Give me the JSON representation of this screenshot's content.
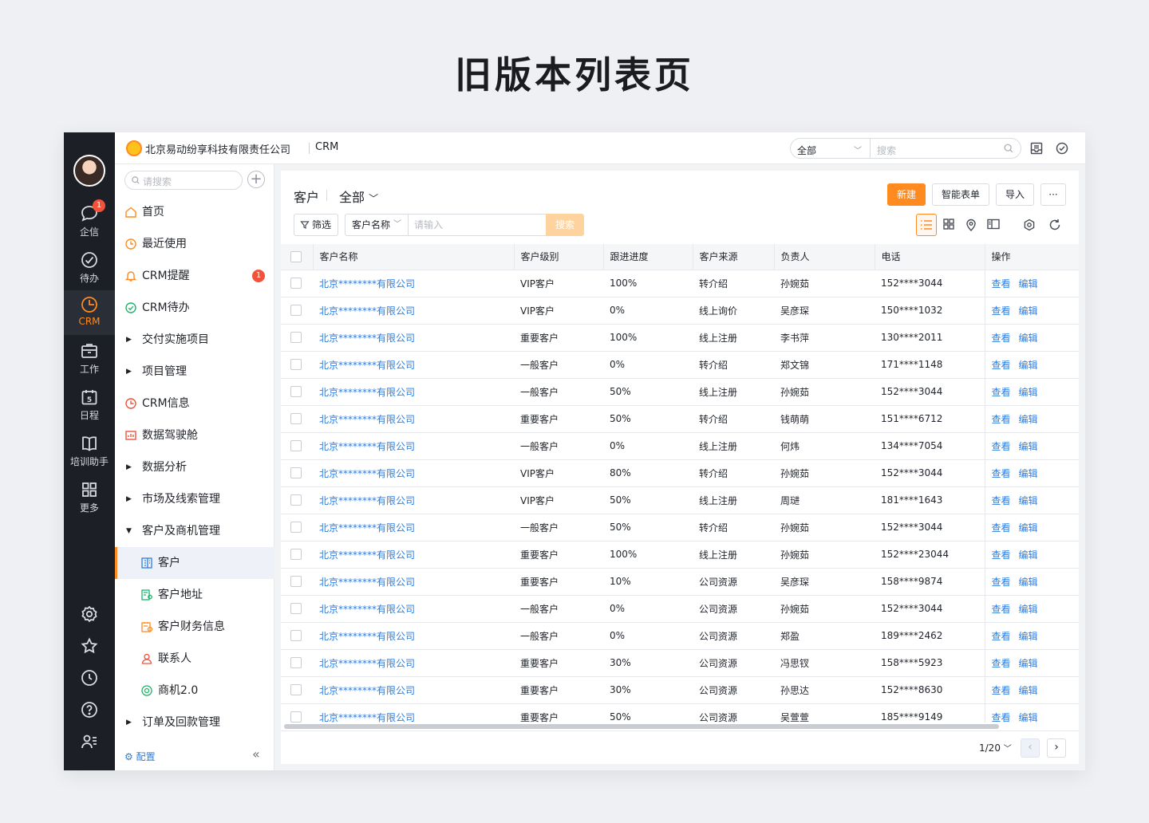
{
  "page_title": "旧版本列表页",
  "topbar": {
    "company": "北京易动纷享科技有限责任公司",
    "app": "CRM",
    "scope": "全部",
    "search_placeholder": "搜索"
  },
  "rail": {
    "chat_badge": "1",
    "items": [
      {
        "label": "企信",
        "icon": "chat-icon"
      },
      {
        "label": "待办",
        "icon": "check-circle-icon"
      },
      {
        "label": "CRM",
        "icon": "clock-pie-icon"
      },
      {
        "label": "工作",
        "icon": "briefcase-icon"
      },
      {
        "label": "日程",
        "icon": "calendar-icon"
      },
      {
        "label": "培训助手",
        "icon": "book-icon"
      },
      {
        "label": "更多",
        "icon": "grid-icon"
      }
    ]
  },
  "nav": {
    "search_placeholder": "请搜索",
    "items": [
      {
        "label": "首页"
      },
      {
        "label": "最近使用"
      },
      {
        "label": "CRM提醒",
        "badge": "1"
      },
      {
        "label": "CRM待办"
      },
      {
        "label": "交付实施项目"
      },
      {
        "label": "项目管理"
      },
      {
        "label": "CRM信息"
      },
      {
        "label": "数据驾驶舱"
      },
      {
        "label": "数据分析"
      },
      {
        "label": "市场及线索管理"
      },
      {
        "label": "客户及商机管理"
      },
      {
        "label": "客户"
      },
      {
        "label": "客户地址"
      },
      {
        "label": "客户财务信息"
      },
      {
        "label": "联系人"
      },
      {
        "label": "商机2.0"
      },
      {
        "label": "订单及回款管理"
      }
    ],
    "config": "配置"
  },
  "list": {
    "title": "客户",
    "view": "全部",
    "buttons": {
      "new": "新建",
      "smart": "智能表单",
      "import": "导入",
      "more": "···"
    },
    "filter": "筛选",
    "field": "客户名称",
    "input_placeholder": "请输入",
    "search": "搜索",
    "columns": [
      "客户名称",
      "客户级别",
      "跟进进度",
      "客户来源",
      "负责人",
      "电话",
      "操作"
    ],
    "op_view": "查看",
    "op_edit": "编辑",
    "rows": [
      [
        "北京********有限公司",
        "VIP客户",
        "100%",
        "转介绍",
        "孙婉茹",
        " 152****3044"
      ],
      [
        "北京********有限公司",
        "VIP客户",
        "0%",
        "线上询价",
        "吴彦琛",
        "150****1032"
      ],
      [
        "北京********有限公司",
        "重要客户",
        "100%",
        "线上注册",
        "李书萍",
        "130****2011"
      ],
      [
        "北京********有限公司",
        "一般客户",
        "0%",
        "转介绍",
        "郑文锦",
        "171****1148"
      ],
      [
        "北京********有限公司",
        "一般客户",
        "50%",
        "线上注册",
        "孙婉茹",
        "152****3044"
      ],
      [
        "北京********有限公司",
        "重要客户",
        "50%",
        "转介绍",
        "钱萌萌",
        "151****6712"
      ],
      [
        "北京********有限公司",
        "一般客户",
        "0%",
        "线上注册",
        "何炜",
        "134****7054"
      ],
      [
        "北京********有限公司",
        "VIP客户",
        "80%",
        "转介绍",
        "孙婉茹",
        "152****3044"
      ],
      [
        "北京********有限公司",
        "VIP客户",
        "50%",
        "线上注册",
        "周琎",
        "181****1643"
      ],
      [
        "北京********有限公司",
        "一般客户",
        "50%",
        "转介绍",
        "孙婉茹",
        "152****3044"
      ],
      [
        "北京********有限公司",
        "重要客户",
        "100%",
        "线上注册",
        "孙婉茹",
        "152****23044"
      ],
      [
        "北京********有限公司",
        "重要客户",
        "10%",
        "公司资源",
        "吴彦琛",
        "158****9874"
      ],
      [
        "北京********有限公司",
        "一般客户",
        "0%",
        "公司资源",
        "孙婉茹",
        "152****3044"
      ],
      [
        "北京********有限公司",
        "一般客户",
        "0%",
        "公司资源",
        "郑盈",
        "189****2462"
      ],
      [
        "北京********有限公司",
        "重要客户",
        "30%",
        "公司资源",
        "冯思钗",
        "158****5923"
      ],
      [
        "北京********有限公司",
        "重要客户",
        "30%",
        "公司资源",
        "孙思达",
        "152****8630"
      ],
      [
        "北京********有限公司",
        "重要客户",
        "50%",
        "公司资源",
        "吴萱萱",
        "185****9149"
      ]
    ],
    "pager": "1/20"
  },
  "colors": {
    "accent": "#ff8a1f",
    "link": "#2a7de1",
    "badge": "#f2513a",
    "rail": "#1c1f26"
  }
}
